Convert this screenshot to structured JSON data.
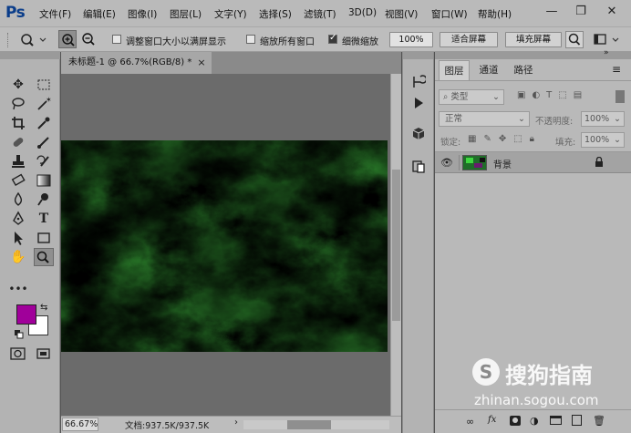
{
  "app": {
    "logo": "Ps"
  },
  "menu": [
    "文件(F)",
    "编辑(E)",
    "图像(I)",
    "图层(L)",
    "文字(Y)",
    "选择(S)",
    "滤镜(T)",
    "3D(D)",
    "视图(V)",
    "窗口(W)",
    "帮助(H)"
  ],
  "window_controls": {
    "minimize": "—",
    "restore": "❐",
    "close": "✕"
  },
  "options": {
    "check1_label": "调整窗口大小以满屏显示",
    "check2_label": "缩放所有窗口",
    "check3_label": "细微缩放",
    "zoom_value": "100%",
    "fit_screen": "适合屏幕",
    "fill_screen": "填充屏幕"
  },
  "document": {
    "tab_title": "未标题-1 @ 66.7%(RGB/8) *",
    "close": "×",
    "zoom": "66.67%",
    "doc_info": "文档:937.5K/937.5K"
  },
  "colors": {
    "foreground": "#a0009a",
    "background": "#ffffff"
  },
  "layers_panel": {
    "tabs": [
      "图层",
      "通道",
      "路径"
    ],
    "filter_label": "类型",
    "blend_mode": "正常",
    "opacity_label": "不透明度:",
    "opacity_value": "100%",
    "lock_label": "锁定:",
    "fill_label": "填充:",
    "fill_value": "100%",
    "layer_name": "背景"
  },
  "watermark": {
    "text": "搜狗指南",
    "url": "zhinan.sogou.com"
  }
}
